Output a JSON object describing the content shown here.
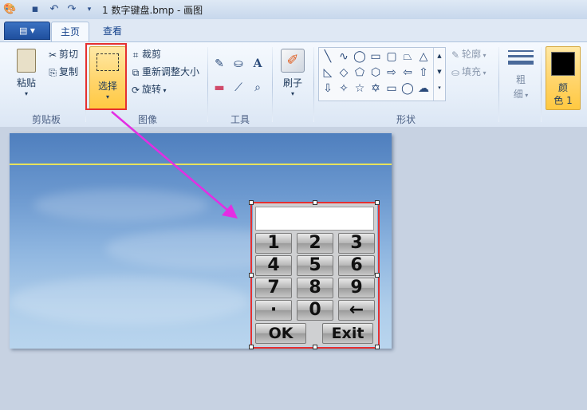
{
  "window": {
    "title": "1 数字键盘.bmp - 画图"
  },
  "tabs": {
    "file": "▾",
    "home": "主页",
    "view": "查看"
  },
  "clipboard": {
    "paste": "粘贴",
    "cut": "剪切",
    "copy": "复制",
    "label": "剪贴板"
  },
  "image": {
    "select": "选择",
    "crop": "裁剪",
    "resize": "重新调整大小",
    "rotate": "旋转",
    "label": "图像"
  },
  "tools": {
    "label": "工具"
  },
  "brush": {
    "label": "刷子"
  },
  "shapes": {
    "outline": "轮廓",
    "fill": "填充",
    "label": "形状"
  },
  "size": {
    "line1": "粗",
    "line2": "细"
  },
  "color1": {
    "line1": "颜",
    "line2": "色 1",
    "value": "#000000"
  },
  "keypad": {
    "keys": [
      "1",
      "2",
      "3",
      "4",
      "5",
      "6",
      "7",
      "8",
      "9",
      "·",
      "0",
      "←"
    ],
    "ok": "OK",
    "exit": "Exit"
  },
  "colors": {
    "highlight": "#e53030",
    "arrow": "#e32ee3",
    "ribbon": "#e7eff9"
  }
}
